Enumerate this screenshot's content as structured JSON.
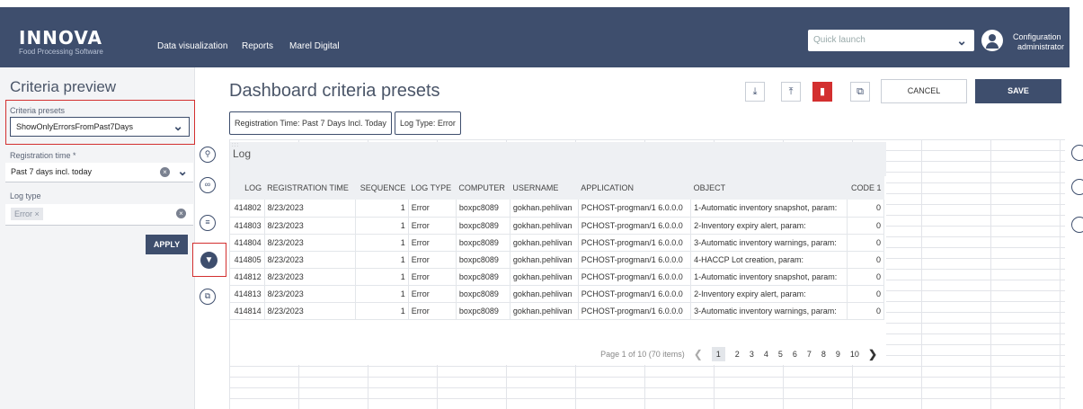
{
  "brand": {
    "name": "INNOVA",
    "tagline": "Food Processing Software"
  },
  "nav": [
    "Data visualization",
    "Reports",
    "Marel Digital"
  ],
  "quick_launch": {
    "placeholder": "Quick launch"
  },
  "user": {
    "line1": "Configuration",
    "line2": "administrator"
  },
  "sidebar": {
    "title": "Criteria preview",
    "presets_label": "Criteria presets",
    "presets_value": "ShowOnlyErrorsFromPast7Days",
    "registration_label": "Registration time *",
    "registration_value": "Past 7 days incl. today",
    "logtype_label": "Log type",
    "logtype_chip": "Error",
    "apply": "APPLY"
  },
  "header": {
    "title": "Dashboard criteria presets",
    "cancel": "CANCEL",
    "save": "SAVE",
    "criteria": [
      "Registration Time: Past 7 Days Incl. Today",
      "Log Type: Error"
    ]
  },
  "widget": {
    "title": "Log",
    "columns": [
      "LOG",
      "REGISTRATION TIME",
      "SEQUENCE",
      "LOG TYPE",
      "COMPUTER",
      "USERNAME",
      "APPLICATION",
      "OBJECT",
      "CODE 1"
    ],
    "rows": [
      [
        "414802",
        "8/23/2023",
        "1",
        "Error",
        "boxpc8089",
        "gokhan.pehlivan",
        "PCHOST-progman/1 6.0.0.0",
        "1-Automatic inventory snapshot, param:",
        "0"
      ],
      [
        "414803",
        "8/23/2023",
        "1",
        "Error",
        "boxpc8089",
        "gokhan.pehlivan",
        "PCHOST-progman/1 6.0.0.0",
        "2-Inventory expiry alert, param:",
        "0"
      ],
      [
        "414804",
        "8/23/2023",
        "1",
        "Error",
        "boxpc8089",
        "gokhan.pehlivan",
        "PCHOST-progman/1 6.0.0.0",
        "3-Automatic inventory warnings, param:",
        "0"
      ],
      [
        "414805",
        "8/23/2023",
        "1",
        "Error",
        "boxpc8089",
        "gokhan.pehlivan",
        "PCHOST-progman/1 6.0.0.0",
        "4-HACCP Lot creation, param:",
        "0"
      ],
      [
        "414812",
        "8/23/2023",
        "1",
        "Error",
        "boxpc8089",
        "gokhan.pehlivan",
        "PCHOST-progman/1 6.0.0.0",
        "1-Automatic inventory snapshot, param:",
        "0"
      ],
      [
        "414813",
        "8/23/2023",
        "1",
        "Error",
        "boxpc8089",
        "gokhan.pehlivan",
        "PCHOST-progman/1 6.0.0.0",
        "2-Inventory expiry alert, param:",
        "0"
      ],
      [
        "414814",
        "8/23/2023",
        "1",
        "Error",
        "boxpc8089",
        "gokhan.pehlivan",
        "PCHOST-progman/1 6.0.0.0",
        "3-Automatic inventory warnings, param:",
        "0"
      ]
    ],
    "pager_info": "Page 1 of 10 (70 items)",
    "pages": [
      "1",
      "2",
      "3",
      "4",
      "5",
      "6",
      "7",
      "8",
      "9",
      "10"
    ]
  },
  "colors": {
    "primary": "#3e4e6d",
    "danger": "#d32f2f"
  }
}
